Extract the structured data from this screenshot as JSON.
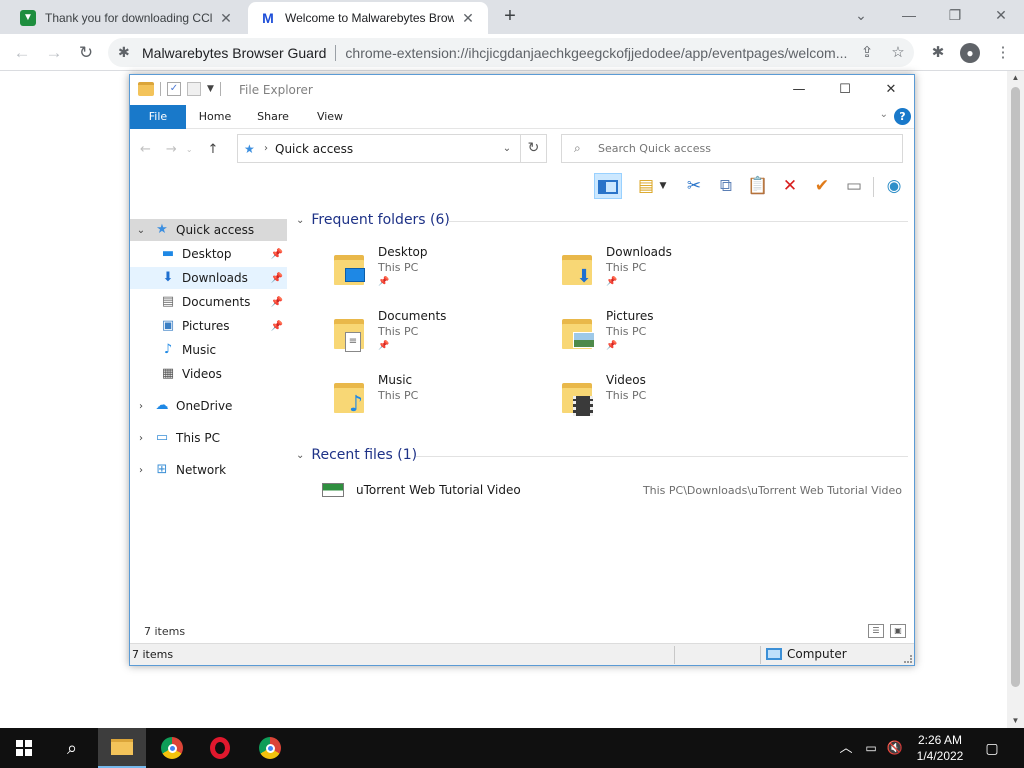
{
  "browser": {
    "tabs": [
      {
        "title": "Thank you for downloading CCle",
        "favicon": "download-page-icon",
        "active": false
      },
      {
        "title": "Welcome to Malwarebytes Brows",
        "favicon": "malwarebytes-icon",
        "active": true
      }
    ],
    "site_name": "Malwarebytes Browser Guard",
    "url": "chrome-extension://ihcjicgdanjaechkgeegckofjjedodee/app/eventpages/welcom..."
  },
  "explorer": {
    "title": "File Explorer",
    "ribbon_tabs": [
      "File",
      "Home",
      "Share",
      "View"
    ],
    "help": "?",
    "address": "Quick access",
    "search_placeholder": "Search Quick access",
    "nav": {
      "quick_access": "Quick access",
      "desktop": "Desktop",
      "downloads": "Downloads",
      "documents": "Documents",
      "pictures": "Pictures",
      "music": "Music",
      "videos": "Videos",
      "onedrive": "OneDrive",
      "this_pc": "This PC",
      "network": "Network"
    },
    "frequent_header": "Frequent folders (6)",
    "folders": [
      {
        "name": "Desktop",
        "location": "This PC",
        "pinned": true
      },
      {
        "name": "Downloads",
        "location": "This PC",
        "pinned": true
      },
      {
        "name": "Documents",
        "location": "This PC",
        "pinned": true
      },
      {
        "name": "Pictures",
        "location": "This PC",
        "pinned": true
      },
      {
        "name": "Music",
        "location": "This PC",
        "pinned": false
      },
      {
        "name": "Videos",
        "location": "This PC",
        "pinned": false
      }
    ],
    "recent_header": "Recent files (1)",
    "recent_files": [
      {
        "name": "uTorrent Web Tutorial Video",
        "path": "This PC\\Downloads\\uTorrent Web Tutorial Video"
      }
    ],
    "status_items": "7 items",
    "status_items_bottom": "7 items",
    "status_computer": "Computer"
  },
  "taskbar": {
    "time": "2:26 AM",
    "date": "1/4/2022"
  },
  "colors": {
    "accent": "#1979ca",
    "taskbar": "#101010",
    "chrome_tabstrip": "#dee1e6"
  }
}
